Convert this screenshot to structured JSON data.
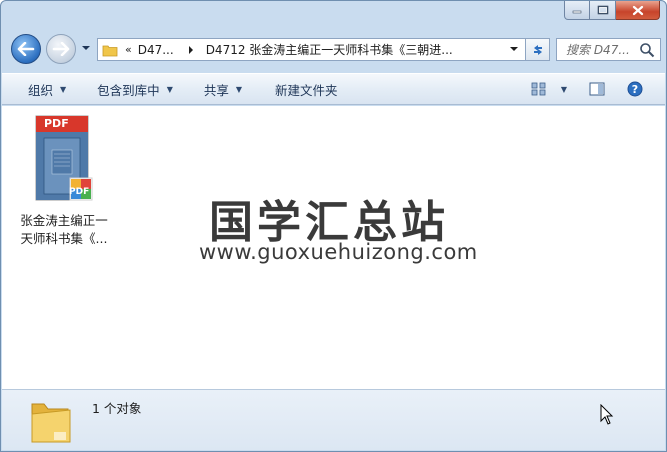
{
  "address": {
    "crumb_root": "D47...",
    "crumb_current": "D4712 张金涛主编正一天师科书集《三朝进...",
    "overflow_glyph": "«"
  },
  "search": {
    "placeholder": "搜索 D47..."
  },
  "toolbar": {
    "organize": "组织",
    "include_in_library": "包含到库中",
    "share": "共享",
    "new_folder": "新建文件夹"
  },
  "file": {
    "label_line1": "张金涛主编正一",
    "label_line2": "天师科书集《...",
    "icon_text": "PDF",
    "badge_text": "PDF"
  },
  "watermark": {
    "title": "国学汇总站",
    "url": "www.guoxuehuizong.com"
  },
  "details": {
    "count_text": "1 个对象"
  },
  "colors": {
    "pdf_red": "#d8372b",
    "nav_blue": "#2c6fc0",
    "folder_yellow": "#f0c64a"
  },
  "icons": [
    "minimize-icon",
    "maximize-icon",
    "close-icon",
    "back-arrow-icon",
    "forward-arrow-icon",
    "folder-icon",
    "refresh-icon",
    "search-icon",
    "view-icon",
    "preview-pane-icon",
    "help-icon",
    "pdf-file-icon",
    "mouse-cursor-icon"
  ]
}
